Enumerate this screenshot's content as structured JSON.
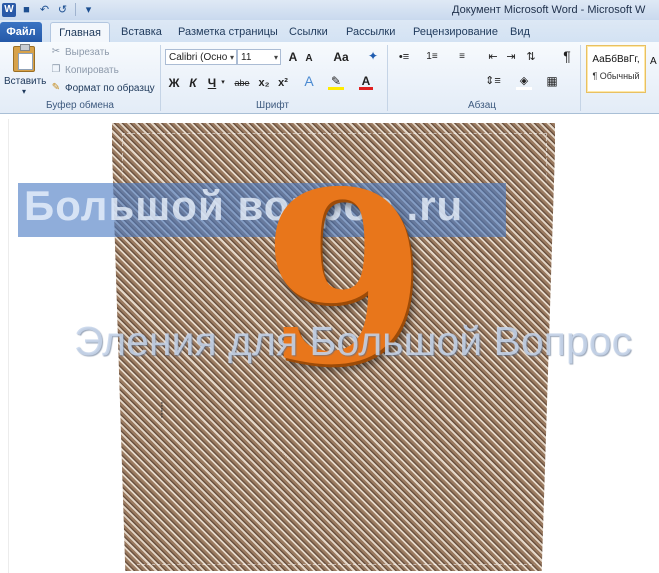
{
  "window": {
    "title": "Документ Microsoft Word - Microsoft W"
  },
  "quick_access": {
    "app_icon": "word-icon",
    "save_icon": "save-icon",
    "undo_icon": "undo-icon",
    "redo_icon": "redo-icon"
  },
  "tabs": {
    "file": "Файл",
    "items": [
      "Главная",
      "Вставка",
      "Разметка страницы",
      "Ссылки",
      "Рассылки",
      "Рецензирование",
      "Вид"
    ],
    "active": "Главная"
  },
  "clipboard": {
    "paste": "Вставить",
    "cut": "Вырезать",
    "copy": "Копировать",
    "format_painter": "Формат по образцу",
    "group_label": "Буфер обмена"
  },
  "font": {
    "font_name": "Calibri (Осно",
    "font_size": "11",
    "group_label": "Шрифт",
    "bold": "Ж",
    "italic": "К",
    "underline": "Ч",
    "strike": "abe",
    "subscript": "x₂",
    "superscript": "x²",
    "grow": "A",
    "shrink": "A",
    "case": "Aa"
  },
  "paragraph": {
    "group_label": "Абзац",
    "pilcrow": "¶"
  },
  "styles": {
    "preview": "АаБбВвГг,",
    "name": "¶ Обычный"
  },
  "document": {
    "banner_text": "Большой вопрос .ru",
    "numeral": "9",
    "author_text": "Эления для Большой Вопрос"
  },
  "colors": {
    "accent_file_tab": "#2559a8",
    "numeral": "#e8761b",
    "banner": "#4a7ac4"
  }
}
